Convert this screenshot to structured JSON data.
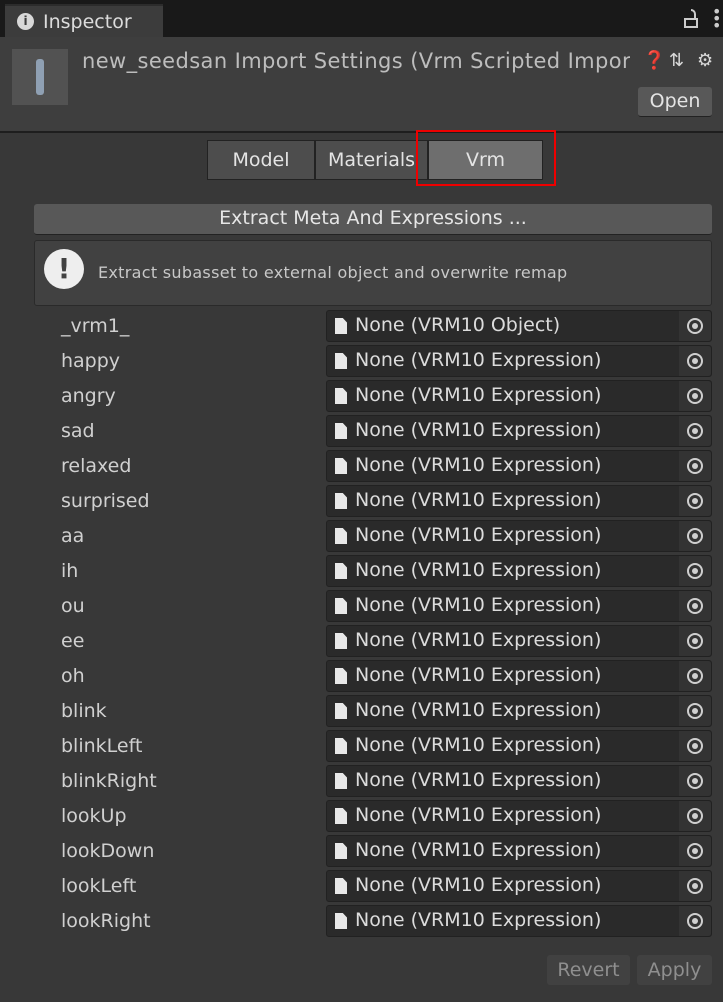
{
  "window": {
    "tab_label": "Inspector"
  },
  "header": {
    "title": "new_seedsan Import Settings (Vrm Scripted Importer)",
    "open_label": "Open"
  },
  "tabs": [
    {
      "label": "Model",
      "selected": false
    },
    {
      "label": "Materials",
      "selected": false
    },
    {
      "label": "Vrm",
      "selected": true
    }
  ],
  "extract_button": "Extract Meta And Expressions ...",
  "help_text": "Extract subasset to external object and overwrite remap",
  "fields": [
    {
      "label": "_vrm1_",
      "value": "None (VRM10 Object)"
    },
    {
      "label": "happy",
      "value": "None (VRM10 Expression)"
    },
    {
      "label": "angry",
      "value": "None (VRM10 Expression)"
    },
    {
      "label": "sad",
      "value": "None (VRM10 Expression)"
    },
    {
      "label": "relaxed",
      "value": "None (VRM10 Expression)"
    },
    {
      "label": "surprised",
      "value": "None (VRM10 Expression)"
    },
    {
      "label": "aa",
      "value": "None (VRM10 Expression)"
    },
    {
      "label": "ih",
      "value": "None (VRM10 Expression)"
    },
    {
      "label": "ou",
      "value": "None (VRM10 Expression)"
    },
    {
      "label": "ee",
      "value": "None (VRM10 Expression)"
    },
    {
      "label": "oh",
      "value": "None (VRM10 Expression)"
    },
    {
      "label": "blink",
      "value": "None (VRM10 Expression)"
    },
    {
      "label": "blinkLeft",
      "value": "None (VRM10 Expression)"
    },
    {
      "label": "blinkRight",
      "value": "None (VRM10 Expression)"
    },
    {
      "label": "lookUp",
      "value": "None (VRM10 Expression)"
    },
    {
      "label": "lookDown",
      "value": "None (VRM10 Expression)"
    },
    {
      "label": "lookLeft",
      "value": "None (VRM10 Expression)"
    },
    {
      "label": "lookRight",
      "value": "None (VRM10 Expression)"
    }
  ],
  "footer": {
    "revert_label": "Revert",
    "apply_label": "Apply"
  },
  "colors": {
    "highlight": "#ee0000",
    "panel": "#383838"
  }
}
